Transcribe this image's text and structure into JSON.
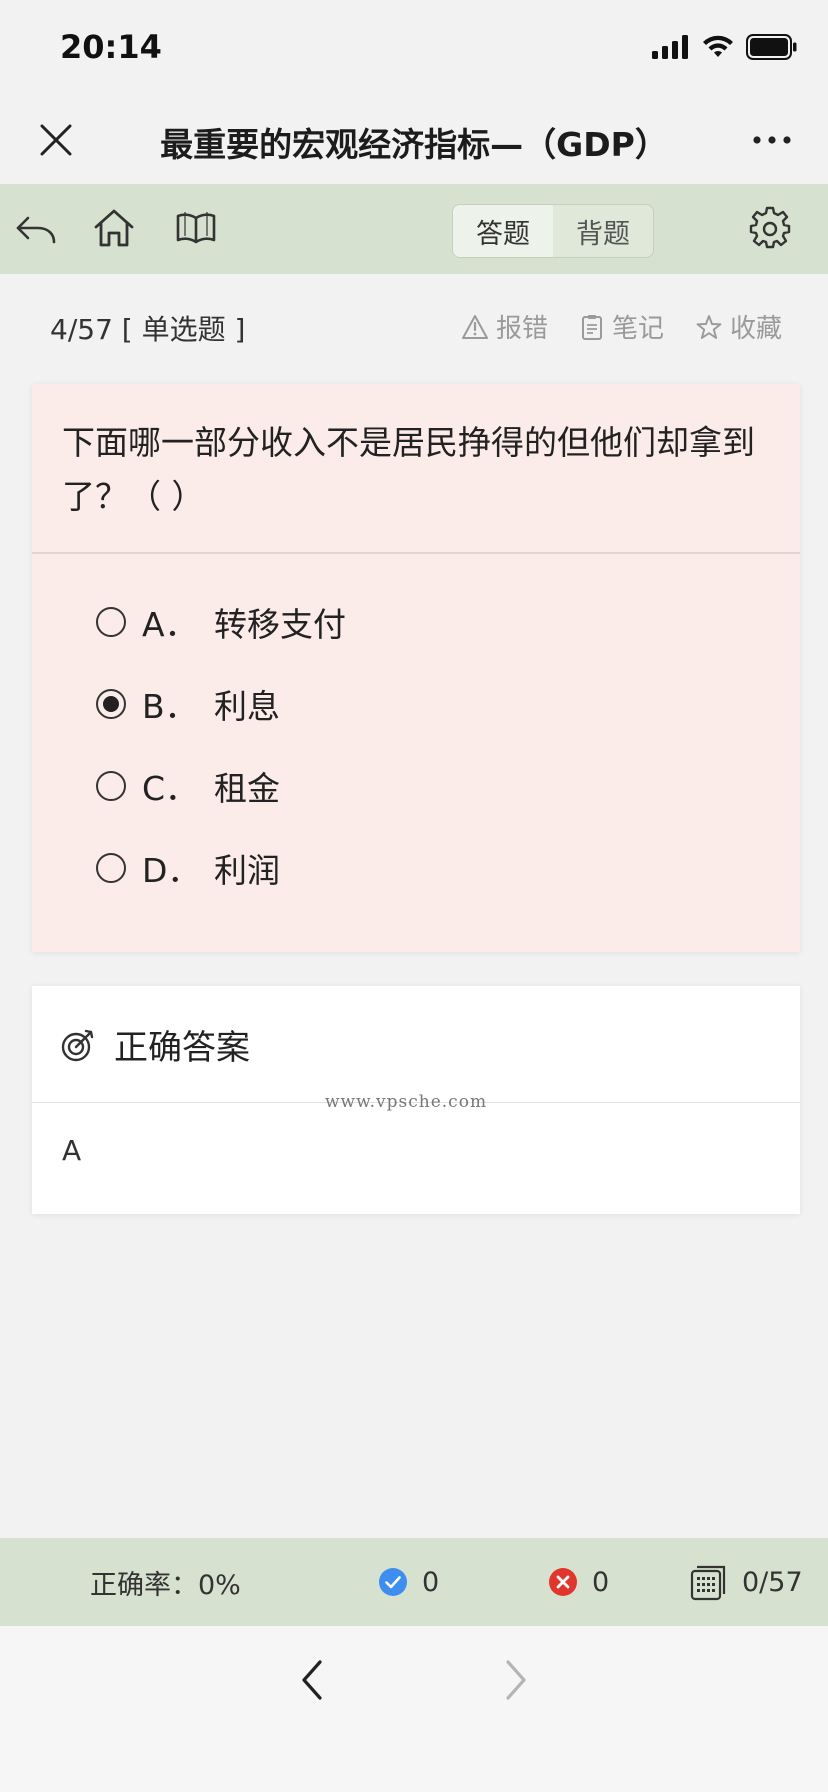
{
  "status_bar": {
    "time": "20:14"
  },
  "nav": {
    "title": "最重要的宏观经济指标—（GDP）"
  },
  "toolbar": {
    "tabs": [
      {
        "label": "答题",
        "active": true
      },
      {
        "label": "背题",
        "active": false
      }
    ]
  },
  "question": {
    "progress": "4/57 [ 单选题 ]",
    "actions": [
      {
        "label": "报错",
        "icon": "warning-icon"
      },
      {
        "label": "笔记",
        "icon": "note-icon"
      },
      {
        "label": "收藏",
        "icon": "star-icon"
      }
    ],
    "stem": "下面哪一部分收入不是居民挣得的但他们却拿到了？（ ）",
    "options": [
      {
        "letter": "A．",
        "text": "转移支付",
        "selected": false
      },
      {
        "letter": "B．",
        "text": "利息",
        "selected": true
      },
      {
        "letter": "C．",
        "text": "租金",
        "selected": false
      },
      {
        "letter": "D．",
        "text": "利润",
        "selected": false
      }
    ]
  },
  "answer": {
    "heading": "正确答案",
    "value": "A",
    "watermark": "www.vpsche.com"
  },
  "stats": {
    "accuracy": "正确率：0%",
    "correct": "0",
    "wrong": "0",
    "answered": "0/57"
  },
  "colors": {
    "toolbar_bg": "#d7e1d0",
    "question_card_bg": "#fbebe9",
    "correct_icon": "#3d8ef0",
    "wrong_icon": "#e0362e"
  }
}
